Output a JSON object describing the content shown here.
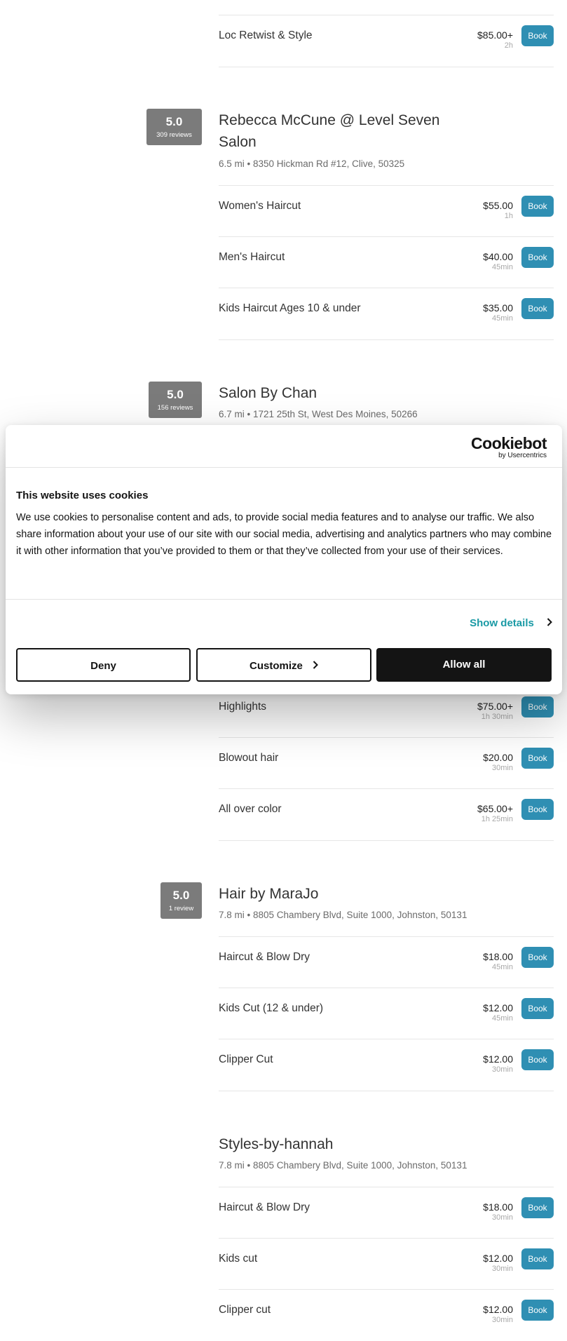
{
  "listings": [
    {
      "services": [
        {
          "name": "Loc Retwist & Style",
          "price": "$85.00+",
          "duration": "2h",
          "book": "Book"
        }
      ]
    },
    {
      "rating": {
        "score": "5.0",
        "reviews": "309 reviews"
      },
      "name": "Rebecca McCune @ Level Seven Salon",
      "address": "6.5 mi • 8350 Hickman Rd #12, Clive, 50325",
      "services": [
        {
          "name": "Women's Haircut",
          "price": "$55.00",
          "duration": "1h",
          "book": "Book"
        },
        {
          "name": "Men's Haircut",
          "price": "$40.00",
          "duration": "45min",
          "book": "Book"
        },
        {
          "name": "Kids Haircut Ages 10 & under",
          "price": "$35.00",
          "duration": "45min",
          "book": "Book"
        }
      ]
    },
    {
      "rating": {
        "score": "5.0",
        "reviews": "156 reviews"
      },
      "name": "Salon By Chan",
      "address": "6.7 mi • 1721 25th St, West Des Moines, 50266",
      "services": [
        {
          "name": "Highlights",
          "price": "$75.00+",
          "duration": "1h 30min",
          "book": "Book"
        },
        {
          "name": "Blowout hair",
          "price": "$20.00",
          "duration": "30min",
          "book": "Book"
        },
        {
          "name": "All over color",
          "price": "$65.00+",
          "duration": "1h 25min",
          "book": "Book"
        }
      ]
    },
    {
      "rating": {
        "score": "5.0",
        "reviews": "1 review"
      },
      "name": "Hair by MaraJo",
      "address": "7.8 mi • 8805 Chambery Blvd, Suite 1000, Johnston, 50131",
      "services": [
        {
          "name": "Haircut & Blow Dry",
          "price": "$18.00",
          "duration": "45min",
          "book": "Book"
        },
        {
          "name": "Kids Cut (12 & under)",
          "price": "$12.00",
          "duration": "45min",
          "book": "Book"
        },
        {
          "name": "Clipper Cut",
          "price": "$12.00",
          "duration": "30min",
          "book": "Book"
        }
      ]
    },
    {
      "name": "Styles-by-hannah",
      "address": "7.8 mi • 8805 Chambery Blvd, Suite 1000, Johnston, 50131",
      "services": [
        {
          "name": "Haircut & Blow Dry",
          "price": "$18.00",
          "duration": "30min",
          "book": "Book"
        },
        {
          "name": "Kids cut",
          "price": "$12.00",
          "duration": "30min",
          "book": "Book"
        },
        {
          "name": "Clipper cut",
          "price": "$12.00",
          "duration": "30min",
          "book": "Book"
        }
      ]
    }
  ],
  "cookie_banner": {
    "logo": {
      "brand": "Cookiebot",
      "sub": "by Usercentrics"
    },
    "title": "This website uses cookies",
    "body": "We use cookies to personalise content and ads, to provide social media features and to analyse our traffic. We also share information about your use of our site with our social media, advertising and analytics partners who may combine it with other information that you’ve provided to them or that they’ve collected from your use of their services.",
    "show_details": "Show details",
    "deny": "Deny",
    "customize": "Customize",
    "allow_all": "Allow all"
  }
}
